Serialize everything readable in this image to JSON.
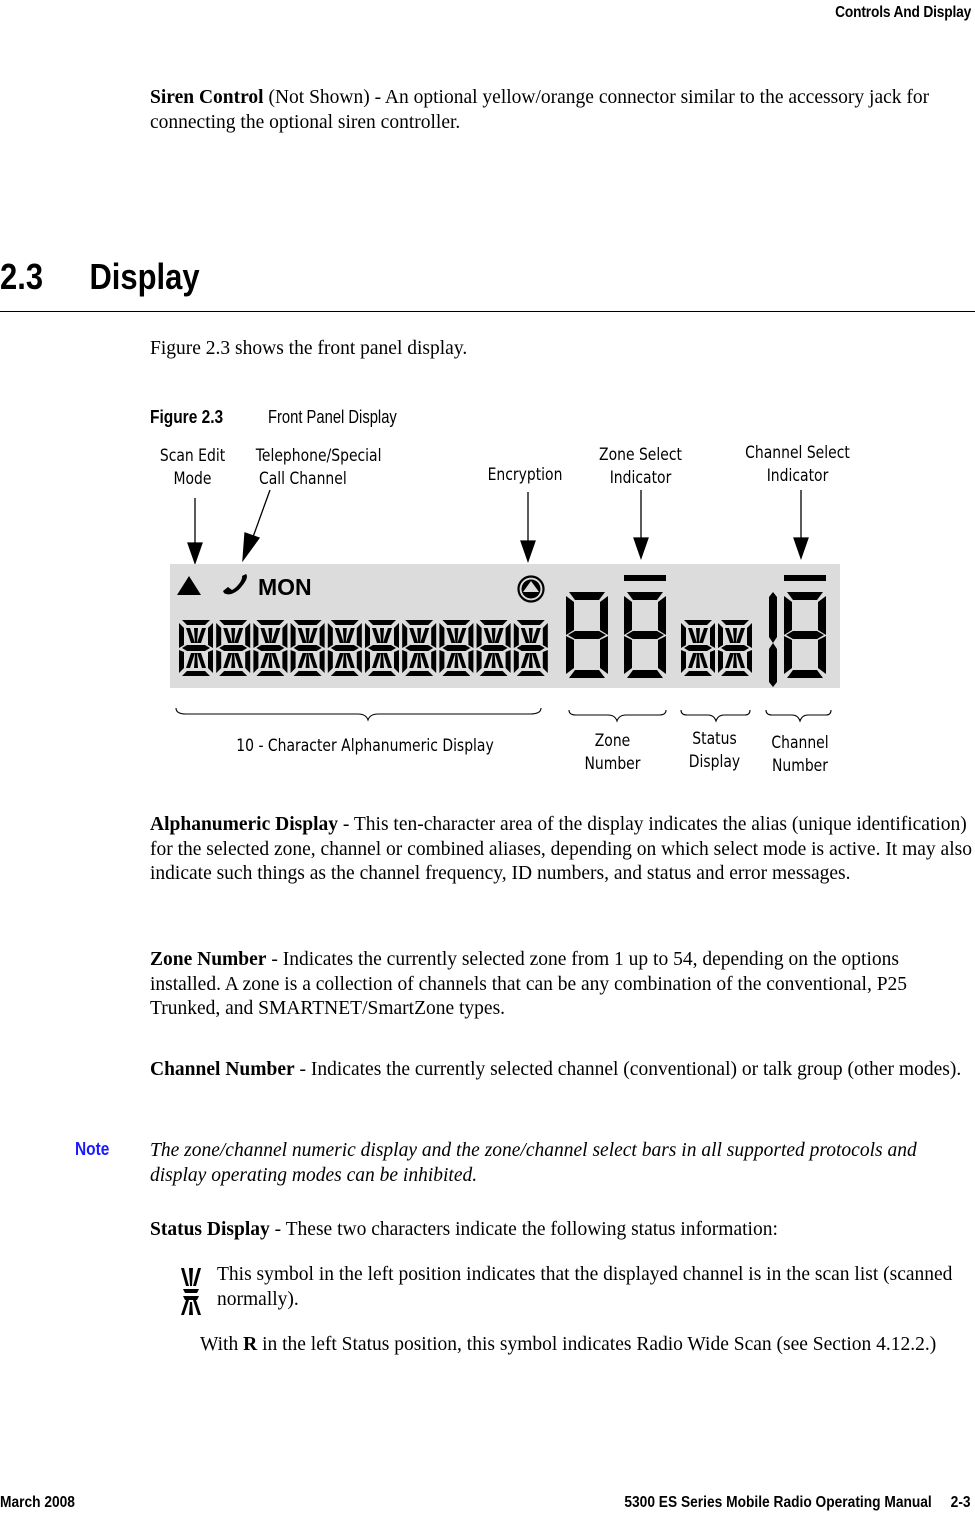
{
  "header": {
    "running_title": "Controls And Display"
  },
  "siren": {
    "term": "Siren Control",
    "text": " (Not Shown) - An optional yellow/orange connector similar to the accessory jack for connecting the optional siren controller."
  },
  "section": {
    "number": "2.3",
    "title": "Display"
  },
  "intro": "Figure 2.3 shows the front panel display.",
  "figure": {
    "number": "Figure 2.3",
    "title": "Front Panel Display",
    "callouts_top": {
      "scan_edit": [
        "Scan Edit",
        "Mode"
      ],
      "telephone": [
        "Telephone/Special",
        "Call Channel"
      ],
      "encryption": [
        "Encryption"
      ],
      "zone_select": [
        "Zone Select",
        "Indicator"
      ],
      "channel_select": [
        "Channel Select",
        "Indicator"
      ]
    },
    "callouts_bottom": {
      "alphanumeric": "10 - Character Alphanumeric Display",
      "zone_number": [
        "Zone",
        "Number"
      ],
      "status_display": [
        "Status",
        "Display"
      ],
      "channel_number": [
        "Channel",
        "Number"
      ]
    },
    "lcd": {
      "mon_label": "MON",
      "alphanumeric_char_count": 10,
      "status_char_count": 2,
      "colors": {
        "panel": "#dcdcdc",
        "segment": "#000000"
      },
      "icons": [
        "scan-edit-triangle-icon",
        "telephone-icon",
        "encryption-icon"
      ]
    }
  },
  "alphanumeric": {
    "term": "Alphanumeric Display",
    "text": " - This ten-character area of the display indicates the alias (unique identification) for the selected zone, channel or combined aliases, depending on which select mode is active. It may also indicate such things as the channel frequency, ID numbers, and status and error messages."
  },
  "zone": {
    "term": "Zone Number",
    "text": " - Indicates the currently selected zone from 1 up to 54, depending on the options installed. A zone is a collection of channels that can be any combination of the conventional, P25 Trunked, and SMARTNET/SmartZone types."
  },
  "channel": {
    "term": "Channel Number",
    "text": " - Indicates the currently selected channel (conventional) or talk group (other modes)."
  },
  "note": {
    "label": "Note",
    "text": "The zone/channel numeric display and the zone/channel select bars in all supported protocols and display operating modes can be inhibited.",
    "color": "#1a1aff"
  },
  "status": {
    "term": "Status Display",
    "text": " - These two characters indicate the following status information:"
  },
  "scan_item": {
    "icon": "scan-list-symbol-icon",
    "text": "This symbol in the left position indicates that the displayed channel is in the scan list (scanned normally)."
  },
  "rws": {
    "pre": "With ",
    "bold": "R",
    "post": " in the left Status position, this symbol indicates Radio Wide Scan (see Section 4.12.2.)"
  },
  "footer": {
    "date": "March 2008",
    "manual": "5300 ES Series Mobile Radio Operating Manual",
    "page": "2-3"
  }
}
